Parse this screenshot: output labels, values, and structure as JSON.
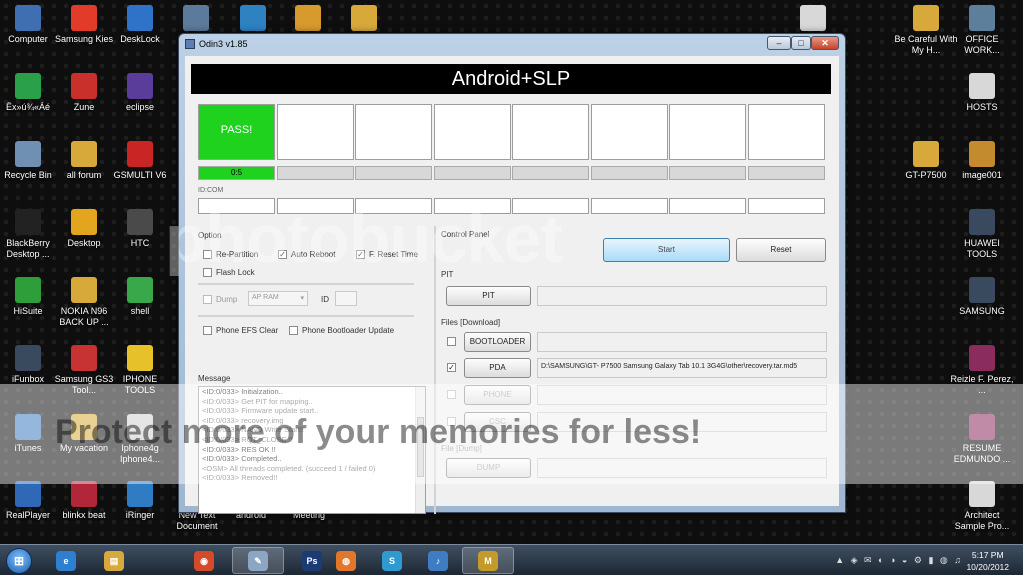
{
  "desktop": {
    "left_icons": [
      {
        "label": "Computer",
        "icon": "computer-icon",
        "color": "#3f6fb0"
      },
      {
        "label": "Samsung Kies",
        "icon": "kies-icon",
        "color": "#e23b2a"
      },
      {
        "label": "DeskLock",
        "icon": "desklock-icon",
        "color": "#2e73c8"
      },
      {
        "label": "Ëx»ú¾«Áé",
        "icon": "app-icon",
        "color": "#2aa04a"
      },
      {
        "label": "Zune",
        "icon": "zune-icon",
        "color": "#c9302c"
      },
      {
        "label": "eclipse",
        "icon": "eclipse-icon",
        "color": "#5a3d9a"
      },
      {
        "label": "Recycle Bin",
        "icon": "recycle-bin-icon",
        "color": "#6f8fb3"
      },
      {
        "label": "all forum",
        "icon": "folder-icon",
        "color": "#d7a93b"
      },
      {
        "label": "GSMULTI V6",
        "icon": "gsmulti-icon",
        "color": "#c92525"
      },
      {
        "label": "BlackBerry Desktop ...",
        "icon": "blackberry-icon",
        "color": "#222222"
      },
      {
        "label": "Desktop",
        "icon": "desktop-icon",
        "color": "#e3a51e"
      },
      {
        "label": "HTC",
        "icon": "htc-icon",
        "color": "#4a4a4a"
      },
      {
        "label": "HiSuite",
        "icon": "hisuite-icon",
        "color": "#2d9e3a"
      },
      {
        "label": "NOKIA N96 BACK UP ...",
        "icon": "folder-icon",
        "color": "#d7a93b"
      },
      {
        "label": "shell",
        "icon": "shell-icon",
        "color": "#38a84a"
      },
      {
        "label": "iFunbox",
        "icon": "ifunbox-icon",
        "color": "#3a4a5e"
      },
      {
        "label": "Samsung GS3 Tool...",
        "icon": "tool-icon",
        "color": "#c73232"
      },
      {
        "label": "IPHONE TOOLS",
        "icon": "star-icon",
        "color": "#e6c12a"
      },
      {
        "label": "iTunes",
        "icon": "itunes-icon",
        "color": "#3e7cc4"
      },
      {
        "label": "My vacation",
        "icon": "folder-icon",
        "color": "#d7a93b"
      },
      {
        "label": "Iphone4g Iphone4...",
        "icon": "document-icon",
        "color": "#d0d0d0"
      },
      {
        "label": "RealPlayer",
        "icon": "realplayer-icon",
        "color": "#2f68b7"
      },
      {
        "label": "blinkx beat",
        "icon": "blinkx-icon",
        "color": "#b2263a"
      },
      {
        "label": "iRinger",
        "icon": "iringer-icon",
        "color": "#2f7bc4"
      }
    ],
    "partial_labels": [
      "New Text Document",
      "android",
      "Meeting"
    ],
    "top_icons": [
      {
        "icon": "phone-icon",
        "color": "#5c7a9c"
      },
      {
        "icon": "globe-icon",
        "color": "#2e82c2"
      },
      {
        "icon": "checklist-icon",
        "color": "#d69b2c"
      },
      {
        "icon": "folder-icon",
        "color": "#d7a93b"
      },
      {
        "icon": "document-icon",
        "color": "#d8d8d8"
      }
    ],
    "right_icons": [
      {
        "label": "Be Careful With My H...",
        "icon": "folder-icon",
        "color": "#d7a93b"
      },
      {
        "label": "OFFICE WORK...",
        "icon": "office-icon",
        "color": "#5e7f9c"
      },
      {
        "label": "HOSTS",
        "icon": "document-icon",
        "color": "#d8d8d8"
      },
      {
        "label": "GT-P7500",
        "icon": "folder-icon",
        "color": "#d7a93b"
      },
      {
        "label": "image001",
        "icon": "image-icon",
        "color": "#c48a2e"
      },
      {
        "label": "HUAWEI TOOLS",
        "icon": "huawei-icon",
        "color": "#3a4a5e"
      },
      {
        "label": "SAMSUNG",
        "icon": "samsung-icon",
        "color": "#3a4a5e"
      },
      {
        "label": "Reizle F. Perez, ...",
        "icon": "winrar-icon",
        "color": "#8a2c5e"
      },
      {
        "label": "RESUME EDMUNDO ...",
        "icon": "winrar-icon",
        "color": "#8a2c5e"
      },
      {
        "label": "Architect Sample Pro...",
        "icon": "document-icon",
        "color": "#d8d8d8"
      }
    ]
  },
  "watermark": {
    "brand": "photobucket",
    "tagline": "Protect more of your memories for less!"
  },
  "odin": {
    "title": "Odin3 v1.85",
    "banner": "Android+SLP",
    "slots": [
      {
        "label": "PASS!",
        "state": "pass"
      },
      {
        "label": "",
        "state": "empty"
      },
      {
        "label": "",
        "state": "empty"
      },
      {
        "label": "",
        "state": "empty"
      },
      {
        "label": "",
        "state": "empty"
      },
      {
        "label": "",
        "state": "empty"
      },
      {
        "label": "",
        "state": "empty"
      },
      {
        "label": "",
        "state": "empty"
      }
    ],
    "first_progress": "0:5",
    "idcom_label": "ID:COM",
    "option": {
      "title": "Option",
      "re_partition": {
        "label": "Re-Partition",
        "checked": false
      },
      "auto_reboot": {
        "label": "Auto Reboot",
        "checked": true
      },
      "f_reset_time": {
        "label": "F. Reset Time",
        "checked": true
      },
      "flash_lock": {
        "label": "Flash Lock",
        "checked": false
      },
      "dump": {
        "label": "Dump",
        "checked": false
      },
      "dump_select": "AP RAM",
      "id_label": "ID",
      "phone_efs_clear": {
        "label": "Phone EFS Clear",
        "checked": false
      },
      "phone_bootloader_update": {
        "label": "Phone Bootloader Update",
        "checked": false
      }
    },
    "message": {
      "title": "Message",
      "lines": [
        "<ID:0/033> Initialzation..",
        "<ID:0/033> Get PIT for mapping..",
        "<ID:0/033> Firmware update start..",
        "<ID:0/033> recovery.img",
        "<ID:0/033> NAND Write Start!!",
        "<ID:0/033> RQT_CLOSE !!",
        "<ID:0/033> RES OK !!",
        "<ID:0/033> Completed..",
        "<OSM> All threads completed. (succeed 1 / failed 0)",
        "<ID:0/033> Removed!!"
      ]
    },
    "control_panel": {
      "title": "Control Panel",
      "start": "Start",
      "reset": "Reset"
    },
    "pit": {
      "title": "PIT",
      "button": "PIT"
    },
    "files": {
      "title": "Files [Download]",
      "bootloader": {
        "label": "BOOTLOADER",
        "checked": false,
        "path": ""
      },
      "pda": {
        "label": "PDA",
        "checked": true,
        "path": "D:\\SAMSUNG\\GT- P7500 Samsung Galaxy Tab 10.1 3G4G\\other\\recovery.tar.md5"
      },
      "phone": {
        "label": "PHONE",
        "checked": false,
        "path": ""
      },
      "csc": {
        "label": "CSC",
        "checked": false,
        "path": ""
      }
    },
    "file_dump": {
      "title": "File [Dump]",
      "button": "DUMP"
    }
  },
  "taskbar": {
    "start_label": "⊞",
    "apps": [
      {
        "name": "ie",
        "icon": "internet-explorer-icon",
        "color": "#2f7fd0",
        "glyph": "e",
        "active": false
      },
      {
        "name": "explorer",
        "icon": "folder-icon",
        "color": "#d7a93b",
        "glyph": "▤",
        "active": false
      },
      {
        "name": "chrome",
        "icon": "chrome-icon",
        "color": "#d44a2a",
        "glyph": "◉",
        "active": false
      },
      {
        "name": "paint",
        "icon": "paint-icon",
        "color": "#8ba7c3",
        "glyph": "✎",
        "active": true
      },
      {
        "name": "photoshop",
        "icon": "photoshop-icon",
        "color": "#1b3b75",
        "glyph": "Ps",
        "active": false
      },
      {
        "name": "firefox",
        "icon": "firefox-icon",
        "color": "#e2762a",
        "glyph": "◍",
        "active": false
      },
      {
        "name": "app",
        "icon": "app-icon",
        "color": "#2f9acf",
        "glyph": "S",
        "active": false
      },
      {
        "name": "itunes",
        "icon": "itunes-icon",
        "color": "#3e7cc4",
        "glyph": "♪",
        "active": false
      },
      {
        "name": "odin",
        "icon": "odin-icon",
        "color": "#c49a2a",
        "glyph": "M",
        "active": true
      }
    ],
    "tray_icons": "▲ ◈ ✉ ◐ ◑ ◒ ⚙ ▮ ◍ ♫",
    "time": "5:17 PM",
    "date": "10/20/2012"
  }
}
